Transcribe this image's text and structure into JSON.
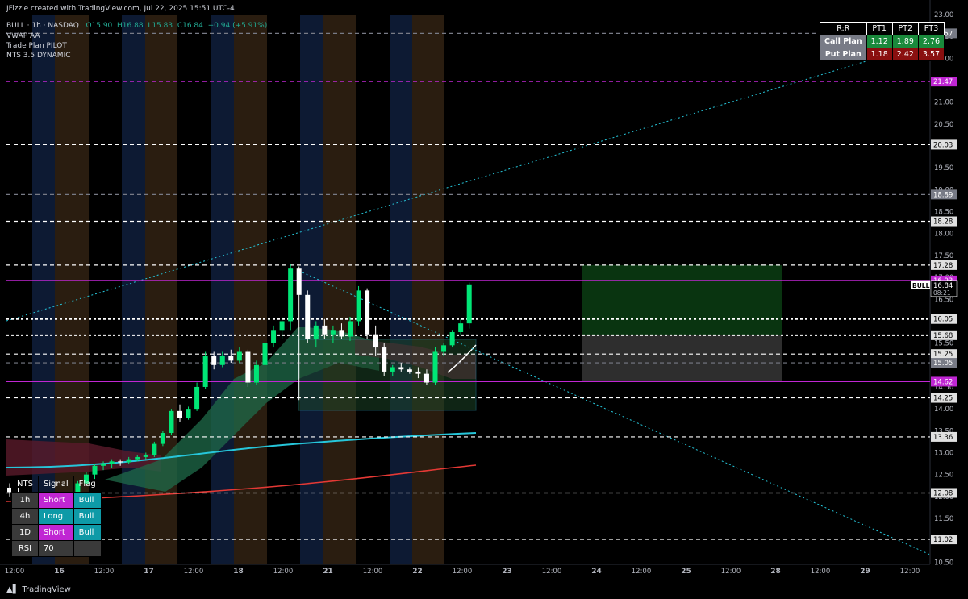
{
  "header": {
    "credit": "JFizzle created with TradingView.com, Jul 22, 2025 15:51 UTC-4",
    "symbol_line": "BULL · 1h · NASDAQ",
    "open": "O15.90",
    "high": "H16.88",
    "low": "L15.83",
    "close": "C16.84",
    "change": "+0.94 (+5.91%)",
    "indicators": [
      "VWAP AA",
      "Trade Plan PILOT",
      "NTS 3.5 DYNAMIC"
    ]
  },
  "rr_table": {
    "header": [
      "R:R",
      "PT1",
      "PT2",
      "PT3"
    ],
    "call": {
      "label": "Call Plan",
      "values": [
        "1.12",
        "1.89",
        "2.76"
      ]
    },
    "put": {
      "label": "Put Plan",
      "values": [
        "1.18",
        "2.42",
        "3.57"
      ]
    }
  },
  "signal_table": {
    "header": [
      "NTS",
      "Signal",
      "Flag"
    ],
    "rows": [
      {
        "tf": "1h",
        "signal": "Short",
        "flag": "Bull"
      },
      {
        "tf": "4h",
        "signal": "Long",
        "flag": "Bull"
      },
      {
        "tf": "1D",
        "signal": "Short",
        "flag": "Bull"
      }
    ],
    "rsi_label": "RSI",
    "rsi_value": "70"
  },
  "branding": "TradingView",
  "chart_data": {
    "type": "candlestick",
    "symbol": "BULL",
    "timeframe": "1h",
    "ylim": [
      10.75,
      23.0
    ],
    "y_ticks": [
      "23.00",
      "22.50",
      "22.00",
      "21.50",
      "21.00",
      "20.50",
      "20.00",
      "19.50",
      "19.00",
      "18.50",
      "18.00",
      "17.50",
      "17.00",
      "16.50",
      "16.00",
      "15.50",
      "15.00",
      "14.50",
      "14.00",
      "13.50",
      "13.00",
      "12.50",
      "12.00",
      "11.50",
      "11.00",
      "10.50"
    ],
    "x_ticks": [
      "12:00",
      "16",
      "12:00",
      "17",
      "12:00",
      "18",
      "12:00",
      "21",
      "12:00",
      "22",
      "12:00",
      "23",
      "12:00",
      "24",
      "12:00",
      "25",
      "12:00",
      "28",
      "12:00",
      "29",
      "12:00"
    ],
    "levels": [
      {
        "value": 22.57,
        "label": "22.57",
        "style": "dashed",
        "color": "#787b86"
      },
      {
        "value": 21.47,
        "label": "21.47",
        "style": "dashed",
        "color": "#c026d3"
      },
      {
        "value": 20.03,
        "label": "20.03",
        "style": "dashed",
        "color": "#ffffff"
      },
      {
        "value": 18.89,
        "label": "18.89",
        "style": "dashed",
        "color": "#787b86"
      },
      {
        "value": 18.28,
        "label": "18.28",
        "style": "dashed",
        "color": "#ffffff"
      },
      {
        "value": 17.28,
        "label": "17.28",
        "style": "dashed",
        "color": "#ffffff"
      },
      {
        "value": 16.93,
        "label": "16.93",
        "style": "solid",
        "color": "#c026d3"
      },
      {
        "value": 16.05,
        "label": "16.05",
        "style": "dotted",
        "color": "#ffffff"
      },
      {
        "value": 15.68,
        "label": "15.68",
        "style": "dotted",
        "color": "#ffffff"
      },
      {
        "value": 15.25,
        "label": "15.25",
        "style": "dashed",
        "color": "#ffffff"
      },
      {
        "value": 15.05,
        "label": "15.05",
        "style": "dashed",
        "color": "#787b86"
      },
      {
        "value": 14.62,
        "label": "14.62",
        "style": "solid",
        "color": "#c026d3"
      },
      {
        "value": 14.25,
        "label": "14.25",
        "style": "dashed",
        "color": "#ffffff"
      },
      {
        "value": 13.36,
        "label": "13.36",
        "style": "dashed",
        "color": "#ffffff"
      },
      {
        "value": 12.08,
        "label": "12.08",
        "style": "dashed",
        "color": "#ffffff"
      },
      {
        "value": 11.02,
        "label": "11.02",
        "style": "dashed",
        "color": "#ffffff"
      }
    ],
    "last_price": {
      "tag": "BULL",
      "value": "16.84",
      "countdown": "08:21"
    },
    "candles": [
      [
        12.2,
        12.3,
        12.0,
        12.1
      ],
      [
        12.1,
        12.2,
        11.9,
        11.95
      ],
      [
        11.95,
        12.1,
        11.8,
        12.05
      ],
      [
        12.05,
        12.1,
        11.9,
        11.92
      ],
      [
        11.92,
        12.0,
        11.7,
        11.75
      ],
      [
        11.75,
        11.9,
        11.6,
        11.85
      ],
      [
        11.85,
        12.0,
        11.8,
        11.95
      ],
      [
        11.95,
        12.1,
        11.9,
        12.05
      ],
      [
        12.05,
        12.35,
        12.0,
        12.3
      ],
      [
        12.3,
        12.55,
        12.25,
        12.5
      ],
      [
        12.5,
        12.75,
        12.4,
        12.7
      ],
      [
        12.7,
        12.8,
        12.6,
        12.75
      ],
      [
        12.75,
        12.85,
        12.65,
        12.8
      ],
      [
        12.8,
        12.85,
        12.7,
        12.78
      ],
      [
        12.78,
        12.9,
        12.75,
        12.85
      ],
      [
        12.85,
        12.95,
        12.8,
        12.9
      ],
      [
        12.9,
        13.0,
        12.85,
        12.95
      ],
      [
        12.95,
        13.25,
        12.9,
        13.2
      ],
      [
        13.2,
        13.5,
        13.15,
        13.45
      ],
      [
        13.45,
        14.0,
        13.4,
        13.95
      ],
      [
        13.95,
        14.1,
        13.7,
        13.8
      ],
      [
        13.8,
        14.05,
        13.75,
        14.0
      ],
      [
        14.0,
        14.6,
        13.95,
        14.5
      ],
      [
        14.5,
        15.3,
        14.45,
        15.2
      ],
      [
        15.2,
        15.3,
        14.9,
        15.0
      ],
      [
        15.0,
        15.3,
        14.95,
        15.2
      ],
      [
        15.2,
        15.35,
        15.05,
        15.1
      ],
      [
        15.1,
        15.4,
        15.05,
        15.3
      ],
      [
        15.3,
        15.35,
        14.5,
        14.6
      ],
      [
        14.6,
        15.1,
        14.55,
        15.0
      ],
      [
        15.0,
        15.6,
        14.95,
        15.5
      ],
      [
        15.5,
        15.9,
        15.4,
        15.8
      ],
      [
        15.8,
        16.1,
        15.6,
        16.0
      ],
      [
        16.0,
        17.3,
        15.8,
        17.2
      ],
      [
        17.2,
        17.25,
        14.2,
        16.6
      ],
      [
        16.6,
        16.7,
        15.5,
        15.6
      ],
      [
        15.6,
        16.0,
        15.4,
        15.9
      ],
      [
        15.9,
        16.05,
        15.6,
        15.7
      ],
      [
        15.7,
        15.9,
        15.5,
        15.8
      ],
      [
        15.8,
        15.95,
        15.6,
        15.65
      ],
      [
        15.65,
        16.1,
        15.55,
        16.0
      ],
      [
        16.0,
        16.8,
        15.9,
        16.7
      ],
      [
        16.7,
        16.75,
        15.6,
        15.7
      ],
      [
        15.7,
        15.9,
        15.2,
        15.4
      ],
      [
        15.4,
        15.5,
        14.75,
        14.85
      ],
      [
        14.85,
        15.0,
        14.75,
        14.95
      ],
      [
        14.95,
        15.05,
        14.85,
        14.9
      ],
      [
        14.9,
        14.95,
        14.8,
        14.85
      ],
      [
        14.85,
        14.95,
        14.7,
        14.8
      ],
      [
        14.8,
        14.9,
        14.55,
        14.6
      ],
      [
        14.6,
        15.4,
        14.55,
        15.3
      ],
      [
        15.3,
        15.5,
        15.2,
        15.45
      ],
      [
        15.45,
        15.8,
        15.4,
        15.75
      ],
      [
        15.75,
        16.05,
        15.7,
        15.95
      ],
      [
        15.95,
        16.88,
        15.83,
        16.84
      ]
    ]
  }
}
